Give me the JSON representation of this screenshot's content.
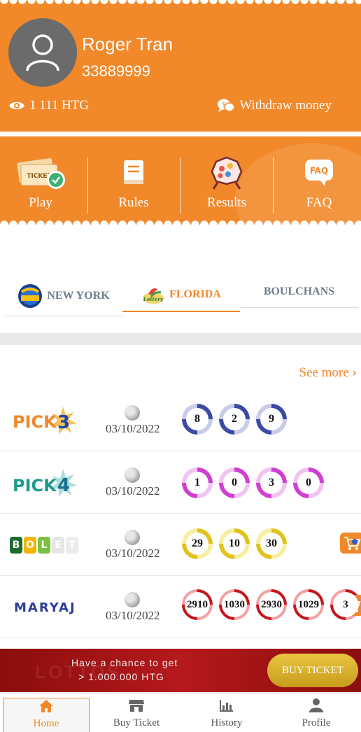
{
  "user": {
    "name": "Roger Tran",
    "phone": "33889999"
  },
  "wallet": {
    "balance": "1 111 HTG",
    "withdraw_label": "Withdraw money"
  },
  "menu": {
    "play": "Play",
    "rules": "Rules",
    "results": "Results",
    "faq": "FAQ",
    "faq_icon_text": "FAQ"
  },
  "tabs": {
    "new_york": "NEW YORK",
    "florida": "FLORIDA",
    "boulchans": "BOULCHANS",
    "active": "FLORIDA"
  },
  "see_more": "See more",
  "results": [
    {
      "game": "PICK3",
      "logo_text": "PICK",
      "logo_digit": "3",
      "date": "03/10/2022",
      "ball_color": "blue",
      "numbers": [
        "8",
        "2",
        "9"
      ]
    },
    {
      "game": "PICK4",
      "logo_text": "PICK",
      "logo_digit": "4",
      "date": "03/10/2022",
      "ball_color": "pink",
      "numbers": [
        "1",
        "0",
        "3",
        "0"
      ]
    },
    {
      "game": "BOLET",
      "logo_letters": [
        "B",
        "O",
        "L",
        "E",
        "T"
      ],
      "date": "03/10/2022",
      "ball_color": "yellow",
      "numbers": [
        "29",
        "10",
        "30"
      ]
    },
    {
      "game": "MARYAJ",
      "logo_text": "MARYAJ",
      "date": "03/10/2022",
      "ball_color": "red",
      "numbers": [
        "2910",
        "1030",
        "2930",
        "1029",
        "3"
      ]
    }
  ],
  "promo": {
    "line1": "Have a chance to get",
    "line2": "> 1.000.000 HTG",
    "watermark": "LOTTOS",
    "button": "BUY TICKET"
  },
  "nav": {
    "home": "Home",
    "buy_ticket": "Buy Ticket",
    "history": "History",
    "profile": "Profile",
    "active": "Home"
  },
  "colors": {
    "accent": "#f1882a",
    "promo_red": "#b5191d",
    "tab_inactive": "#6e7d8c"
  }
}
